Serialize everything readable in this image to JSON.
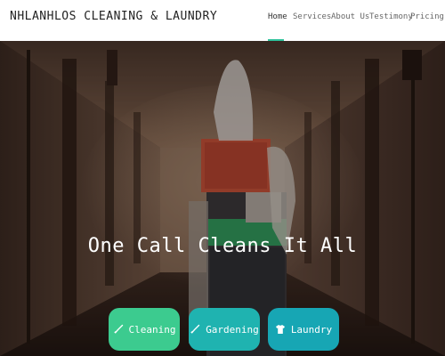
{
  "brand": {
    "name": "NHLANHLOS CLEANING & LAUNDRY"
  },
  "nav": {
    "items": [
      {
        "label": "Home",
        "active": true
      },
      {
        "label": "Services",
        "active": false
      },
      {
        "label": "About Us",
        "active": false
      },
      {
        "label": "Testimony",
        "active": false
      },
      {
        "label": "Pricing",
        "active": false
      }
    ]
  },
  "hero": {
    "tagline": "One Call Cleans It All",
    "buttons": [
      {
        "label": "Cleaning",
        "icon": "broom-icon",
        "color": "#3ccb8f"
      },
      {
        "label": "Gardening",
        "icon": "broom-icon",
        "color": "#1fb3b0"
      },
      {
        "label": "Laundry",
        "icon": "shirt-icon",
        "color": "#17a6b4"
      }
    ]
  },
  "colors": {
    "accent": "#2fc29b"
  }
}
